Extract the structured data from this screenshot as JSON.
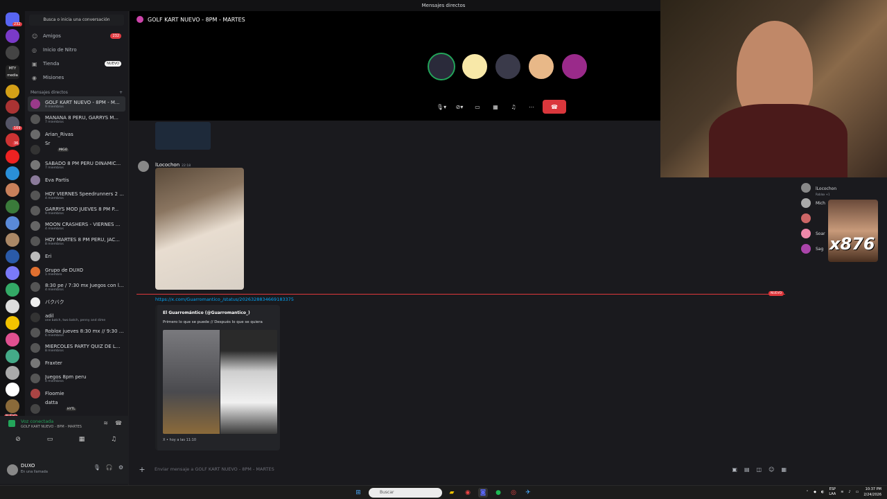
{
  "window": {
    "title": "Mensajes directos"
  },
  "rail": {
    "badges": [
      "232",
      "3",
      "169",
      "36",
      "4"
    ],
    "new_tag": "NUEVO",
    "logo_text": "MTY media"
  },
  "sidebar": {
    "search_placeholder": "Busca o inicia una conversación",
    "nav": [
      {
        "label": "Amigos",
        "badge": "232"
      },
      {
        "label": "Inicio de Nitro",
        "badge": ""
      },
      {
        "label": "Tienda",
        "badge": "NUEVO"
      },
      {
        "label": "Misiones",
        "badge": ""
      }
    ],
    "section_title": "Mensajes directos",
    "dms": [
      {
        "name": "GOLF KART NUEVO - 8PM - M...",
        "sub": "9 miembros",
        "active": true
      },
      {
        "name": "MAÑANA 8 PERU, GARRYS M...",
        "sub": "7 miembros"
      },
      {
        "name": "Arian_Rivas",
        "sub": ""
      },
      {
        "name": "Sr",
        "sub": "",
        "tag": "MIGO"
      },
      {
        "name": "SABADO 8 PM PERU DINAMIC...",
        "sub": "7 miembros"
      },
      {
        "name": "Eva Partis",
        "sub": ""
      },
      {
        "name": "HOY VIERNES Speedrunners 2 ...",
        "sub": "4 miembros"
      },
      {
        "name": "GARRYS MOD JUEVES 8 PM P...",
        "sub": "9 miembros"
      },
      {
        "name": "MOON CRASHERS - VIERNES ...",
        "sub": "4 miembros"
      },
      {
        "name": "HOY MARTES 8 PM PERU, JAC...",
        "sub": "8 miembros"
      },
      {
        "name": "Eri",
        "sub": ""
      },
      {
        "name": "Grupo de DUXO",
        "sub": "1 miembro"
      },
      {
        "name": "8:30 pe / 7:30 mx Juegos con l...",
        "sub": "4 miembros"
      },
      {
        "name": "バクバク",
        "sub": ""
      },
      {
        "name": "adil",
        "sub": "one batch, two batch, penny and dime"
      },
      {
        "name": "Roblox jueves 8:30 mx // 9:30 pe",
        "sub": "6 miembros"
      },
      {
        "name": "MIERCOLES PARTY QUIZ DE L...",
        "sub": "8 miembros"
      },
      {
        "name": "Fraxter",
        "sub": ""
      },
      {
        "name": "Juegos 8pm peru",
        "sub": "4 miembros"
      },
      {
        "name": "Floomie",
        "sub": ""
      },
      {
        "name": "datta",
        "sub": "",
        "tag": "HYTL"
      }
    ]
  },
  "voice": {
    "status": "Voz conectada",
    "channel": "GOLF KART NUEVO - 8PM - MARTES"
  },
  "user": {
    "name": "DUXO",
    "status": "En una llamada"
  },
  "call": {
    "title": "GOLF KART NUEVO - 8PM - MARTES"
  },
  "messages": {
    "author": "lLocochon",
    "timestamp": "22:18",
    "new_label": "NUEVO",
    "link": "https://x.com/Guarromantico_/status/2026328834669183375",
    "embed": {
      "author": "El Guarromántico (@Guarromantico_)",
      "text": "Primero lo que se puede // Después lo que se quiera",
      "footer": "X • hoy a las 11:10"
    }
  },
  "composer": {
    "placeholder": "Enviar mensaje a GOLF KART NUEVO - 8PM - MARTES"
  },
  "members": [
    {
      "name": "lLocochon",
      "sub": "Roblox +1"
    },
    {
      "name": "Mich",
      "sub": ""
    },
    {
      "name": "",
      "sub": ""
    },
    {
      "name": "Soar",
      "sub": ""
    },
    {
      "name": "Sag",
      "sub": ""
    }
  ],
  "overlay": {
    "multiplier": "x876"
  },
  "taskbar": {
    "search_placeholder": "Buscar",
    "lang": "ESP",
    "lang2": "LAA",
    "time": "10:37 PM",
    "date": "2/24/2026"
  },
  "colors": {
    "accent": "#5865f2",
    "danger": "#da373c",
    "online": "#23a55a",
    "link": "#00a8fc"
  }
}
